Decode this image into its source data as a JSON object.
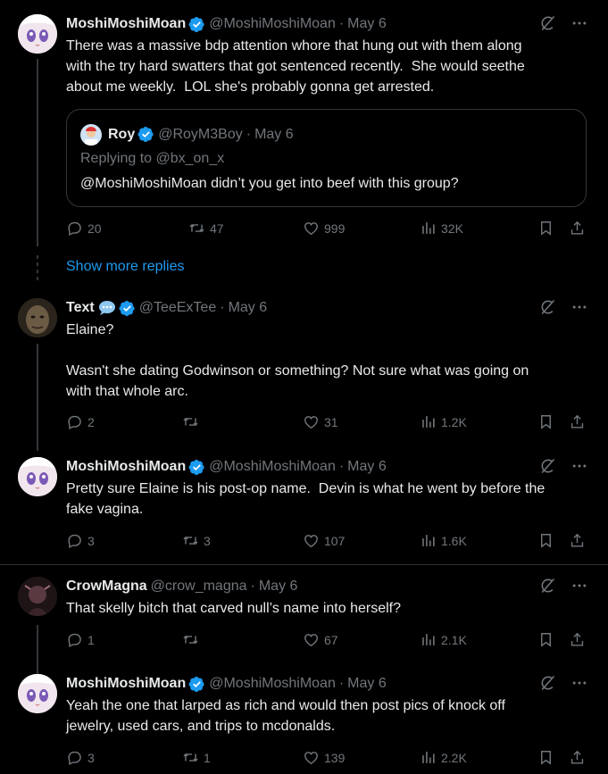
{
  "tweets": [
    {
      "name": "MoshiMoshiMoan",
      "handle": "@MoshiMoshiMoan",
      "date": "May 6",
      "text": "There was a massive bdp attention whore that hung out with them along\nwith the try hard swatters that got sentenced recently.  She would seethe\nabout me weekly.  LOL she's probably gonna get arrested.",
      "replies": "20",
      "retweets": "47",
      "likes": "999",
      "views": "32K"
    },
    {
      "name": "Text",
      "handle": "@TeeExTee",
      "date": "May 6",
      "text": "Elaine?\n\nWasn't she dating Godwinson or something? Not sure what was going on\nwith that whole arc.",
      "replies": "2",
      "retweets": "",
      "likes": "31",
      "views": "1.2K"
    },
    {
      "name": "MoshiMoshiMoan",
      "handle": "@MoshiMoshiMoan",
      "date": "May 6",
      "text": "Pretty sure Elaine is his post-op name.  Devin is what he went by before the\nfake vagina.",
      "replies": "3",
      "retweets": "3",
      "likes": "107",
      "views": "1.6K"
    },
    {
      "name": "CrowMagna",
      "handle": "@crow_magna",
      "date": "May 6",
      "text": "That skelly bitch that carved null’s name into herself?",
      "replies": "1",
      "retweets": "",
      "likes": "67",
      "views": "2.1K"
    },
    {
      "name": "MoshiMoshiMoan",
      "handle": "@MoshiMoshiMoan",
      "date": "May 6",
      "text": "Yeah the one that larped as rich and would then post pics of knock off\njewelry, used cars, and trips to mcdonalds.",
      "replies": "3",
      "retweets": "1",
      "likes": "139",
      "views": "2.2K"
    }
  ],
  "quote": {
    "name": "Roy",
    "handle": "@RoyM3Boy",
    "date": "May 6",
    "replying_to": "Replying to @bx_on_x",
    "text": "@MoshiMoshiMoan didn’t you get into beef with this group?"
  },
  "show_more_replies": "Show more replies",
  "separator": "·",
  "colors": {
    "link": "#1d9bf0",
    "muted": "#71767b",
    "verified": "#1d9bf0"
  }
}
